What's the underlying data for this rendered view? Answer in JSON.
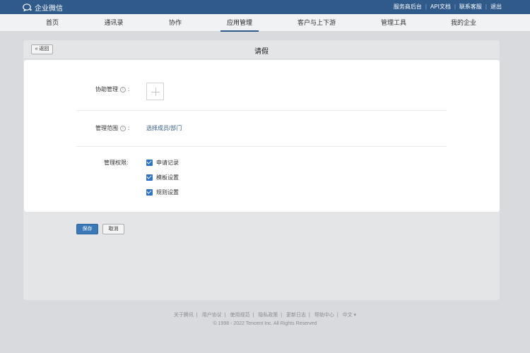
{
  "app": {
    "name": "企业微信"
  },
  "top_links": [
    "服务商后台",
    "API文档",
    "联系客服",
    "退出"
  ],
  "nav": {
    "tabs": [
      "首页",
      "通讯录",
      "协作",
      "应用管理",
      "客户与上下游",
      "管理工具",
      "我的企业"
    ],
    "active": "应用管理"
  },
  "page": {
    "back_label": "« 返回",
    "title": "请假"
  },
  "form": {
    "admin_label": "协助管理",
    "scope_label": "管理范围",
    "scope_link": "选择成员/部门",
    "perm_label": "管理权限:",
    "permissions": [
      {
        "label": "申请记录",
        "checked": true
      },
      {
        "label": "模板设置",
        "checked": true
      },
      {
        "label": "规则设置",
        "checked": true
      }
    ],
    "info_glyph": "i",
    "colon": ":"
  },
  "actions": {
    "save": "保存",
    "cancel": "取消"
  },
  "footer": {
    "links": [
      "关于腾讯",
      "用户协议",
      "使用规范",
      "隐私政策",
      "更新日志",
      "帮助中心",
      "中文 ▾"
    ],
    "copyright": "© 1998 - 2022 Tencent Inc. All Rights Reserved"
  },
  "colors": {
    "brand": "#2f5a8a",
    "checkbox": "#2b72c8",
    "save": "#3a78b8"
  }
}
